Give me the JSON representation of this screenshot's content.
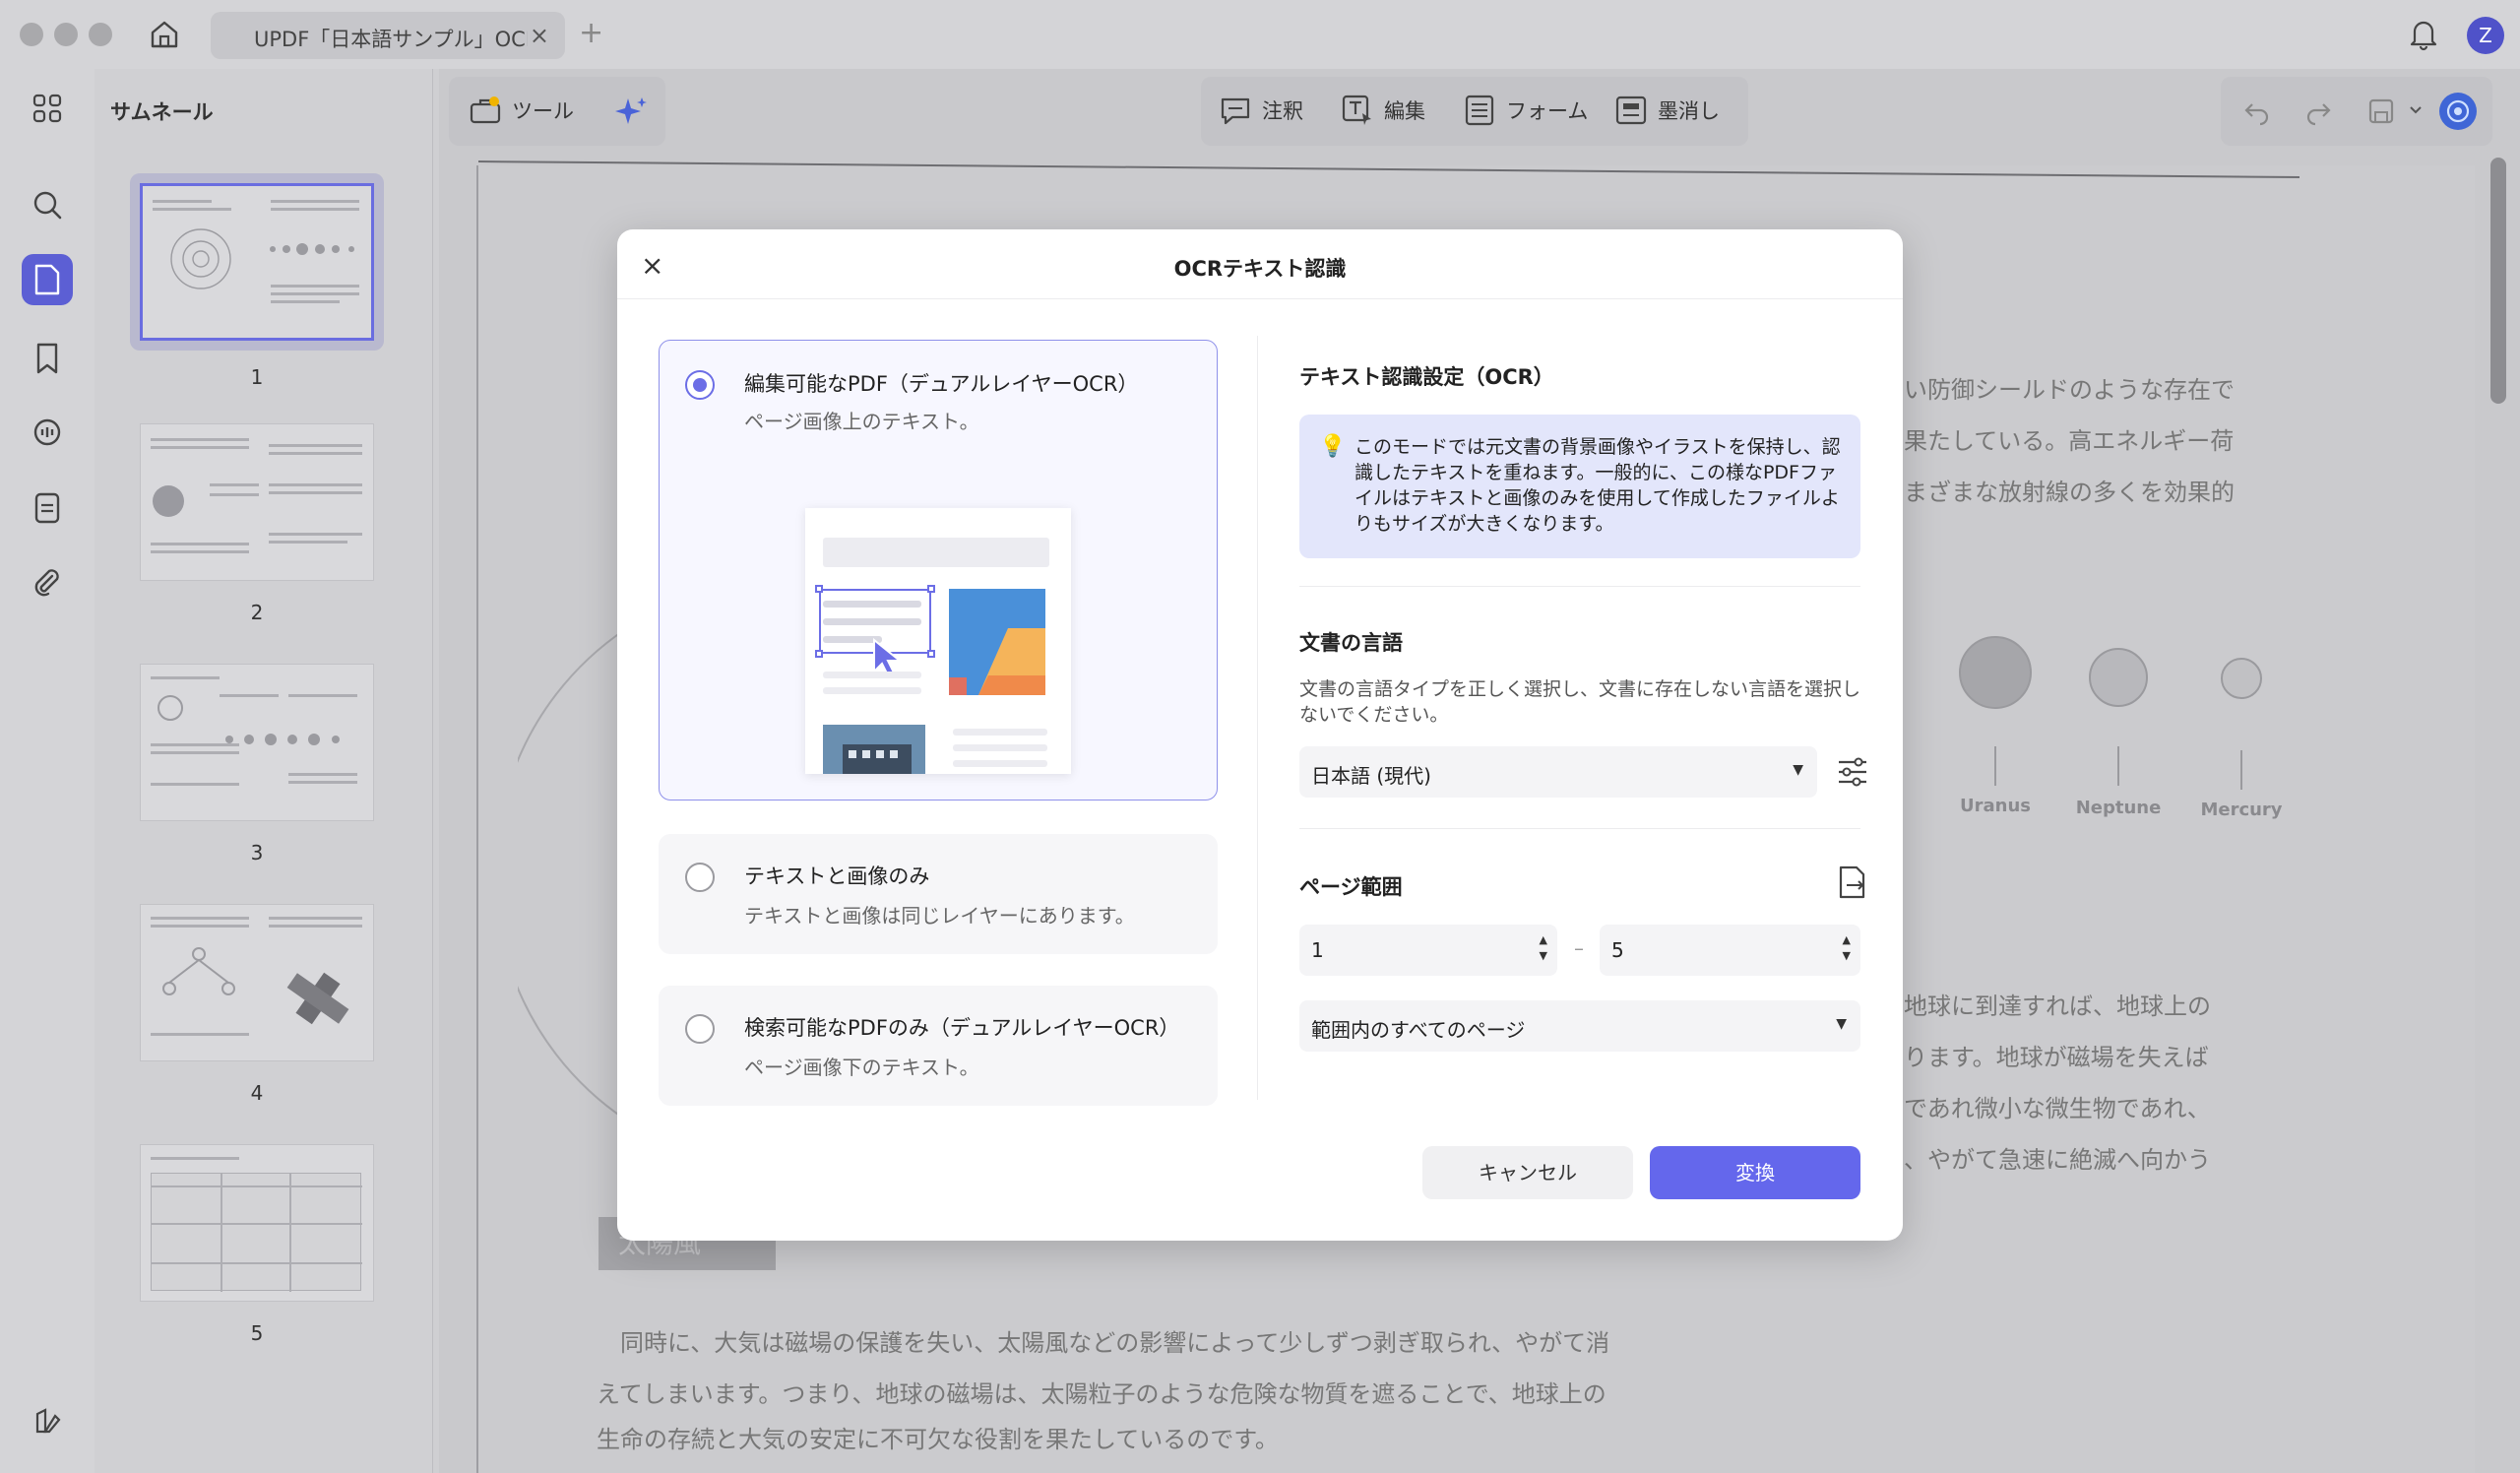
{
  "window": {
    "tab_title": "UPDF「日本語サンプル」OCR",
    "tab_close": "×",
    "tab_add": "+",
    "avatar_initial": "Z"
  },
  "sidebar": {
    "heading": "サムネール",
    "pages": [
      "1",
      "2",
      "3",
      "4",
      "5"
    ],
    "selected_page": "1"
  },
  "toolbar": {
    "tools_label": "ツール",
    "comment_label": "注釈",
    "edit_label": "編集",
    "form_label": "フォーム",
    "redact_label": "墨消し"
  },
  "document": {
    "lines_right_top": [
      "い防御シールドのような存在で",
      "果たしている。高エネルギー荷",
      "まざまな放射線の多くを効果的"
    ],
    "planets": [
      "Uranus",
      "Neptune",
      "Mercury"
    ],
    "lines_right_mid": [
      "地球に到達すれば、地球上の",
      "ります。地球が磁場を失えば",
      "であれ微小な微生物であれ、",
      "、やがて急速に絶滅へ向かう"
    ],
    "section_tag": "太陽風",
    "lines_bottom": [
      "同時に、大気は磁場の保護を失い、太陽風などの影響によって少しずつ剥ぎ取られ、やがて消",
      "えてしまいます。つまり、地球の磁場は、太陽粒子のような危険な物質を遮ることで、地球上の",
      "生命の存続と大気の安定に不可欠な役割を果たしているのです。"
    ]
  },
  "ocr_dialog": {
    "title": "OCRテキスト認識",
    "close": "×",
    "options": [
      {
        "title": "編集可能なPDF（デュアルレイヤーOCR）",
        "subtitle": "ページ画像上のテキスト。",
        "selected": true
      },
      {
        "title": "テキストと画像のみ",
        "subtitle": "テキストと画像は同じレイヤーにあります。",
        "selected": false
      },
      {
        "title": "検索可能なPDFのみ（デュアルレイヤーOCR）",
        "subtitle": "ページ画像下のテキスト。",
        "selected": false
      }
    ],
    "settings_heading": "テキスト認識設定（OCR）",
    "info_text": "このモードでは元文書の背景画像やイラストを保持し、認識したテキストを重ねます。一般的に、この様なPDFファイルはテキストと画像のみを使用して作成したファイルよりもサイズが大きくなります。",
    "language_heading": "文書の言語",
    "language_desc": "文書の言語タイプを正しく選択し、文書に存在しない言語を選択しないでください。",
    "language_value": "日本語 (現代)",
    "page_range_heading": "ページ範囲",
    "range_from": "1",
    "range_to": "5",
    "range_dash": "–",
    "page_scope_value": "範囲内のすべてのページ",
    "cancel_label": "キャンセル",
    "convert_label": "変換"
  },
  "colors": {
    "accent": "#6467ec",
    "radio_selected": "#6c6ee6",
    "info_bg": "#e3e6fb"
  }
}
